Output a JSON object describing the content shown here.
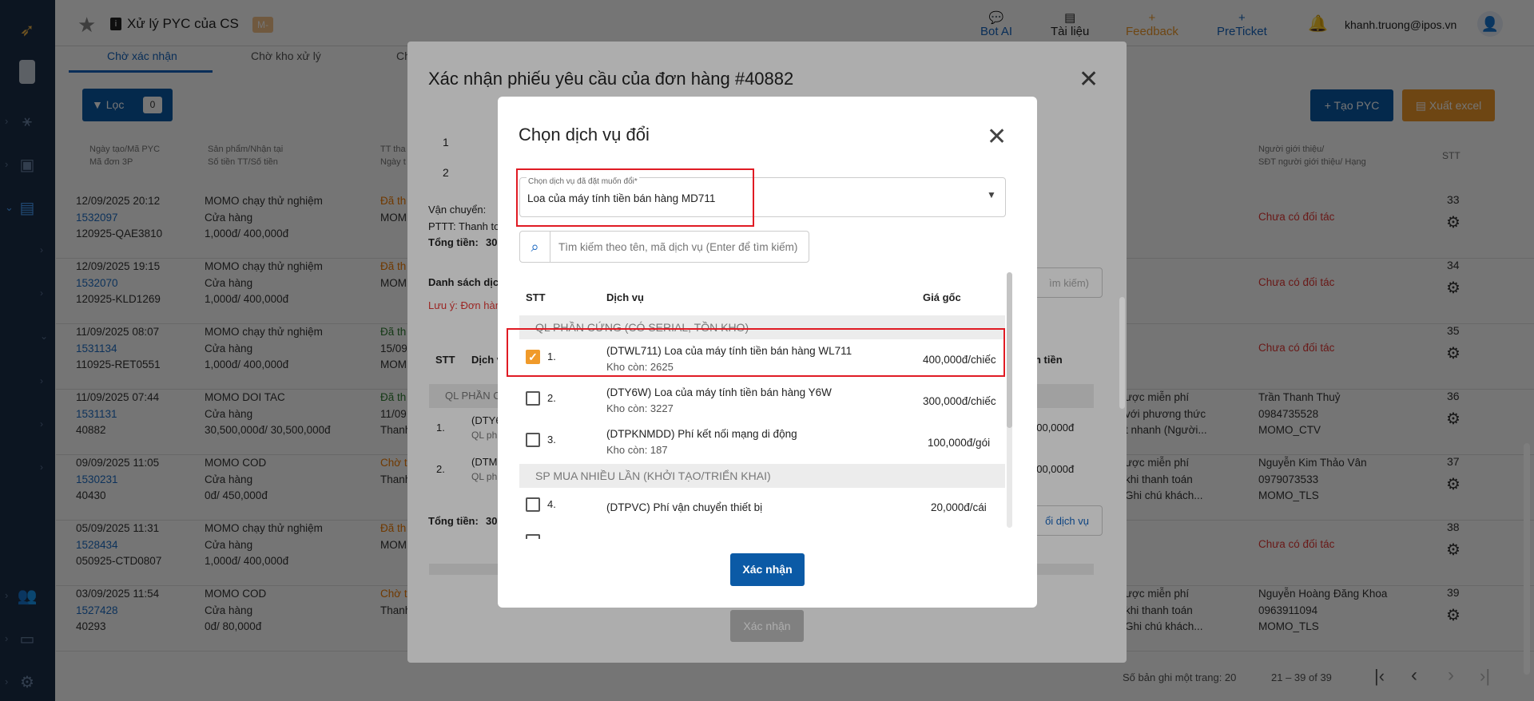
{
  "app": {
    "title": "Xử lý PYC của CS",
    "badge": "M-",
    "user": "khanh.truong@ipos.vn"
  },
  "topbar": {
    "bot_ai": "Bot AI",
    "tai_lieu": "Tài liệu",
    "feedback": "Feedback",
    "preticket": "PreTicket"
  },
  "tabs": [
    "Chờ xác nhận",
    "Chờ kho xử lý",
    "Ch"
  ],
  "toolbar": {
    "filter": "Lọc",
    "filter_count": "0",
    "create": "Tạo PYC",
    "export": "Xuất excel"
  },
  "table": {
    "headers": {
      "col1a": "Ngày tạo/Mã PYC",
      "col1b": "Mã đơn 3P",
      "col2a": "Sản phẩm/Nhận tại",
      "col2b": "Số tiền TT/Số tiền",
      "col3a": "TT tha",
      "col3b": "Ngày t",
      "col4a": "Người giới thiệu/",
      "col4b": "SĐT người giới thiệu/ Hạng",
      "stt": "STT"
    },
    "rows": [
      {
        "date": "12/09/2025 20:12",
        "code": "1532097",
        "ext": "120925-QAE3810",
        "p1": "MOMO chạy thử nghiệm",
        "p2": "Cửa hàng",
        "p3": "1,000đ/ 400,000đ",
        "s1": "Đã th",
        "s2": "MOM",
        "s3": "",
        "m1": "",
        "m2": "",
        "m3": "",
        "r1": "Chưa có đối tác",
        "r2": "",
        "r3": "",
        "stt": "33"
      },
      {
        "date": "12/09/2025 19:15",
        "code": "1532070",
        "ext": "120925-KLD1269",
        "p1": "MOMO chạy thử nghiệm",
        "p2": "Cửa hàng",
        "p3": "1,000đ/ 400,000đ",
        "s1": "Đã th",
        "s2": "MOM",
        "s3": "",
        "m1": "",
        "m2": "",
        "m3": "",
        "r1": "Chưa có đối tác",
        "r2": "",
        "r3": "",
        "stt": "34"
      },
      {
        "date": "11/09/2025 08:07",
        "code": "1531134",
        "ext": "110925-RET0551",
        "p1": "MOMO chạy thử nghiệm",
        "p2": "Cửa hàng",
        "p3": "1,000đ/ 400,000đ",
        "s1": "Đã th",
        "s2": "15/09",
        "s3": "MOM",
        "m1": "",
        "m2": "",
        "m3": "",
        "r1": "Chưa có đối tác",
        "r2": "",
        "r3": "",
        "stt": "35"
      },
      {
        "date": "11/09/2025 07:44",
        "code": "1531131",
        "ext": "40882",
        "p1": "MOMO DOI TAC",
        "p2": "Cửa hàng",
        "p3": "30,500,000đ/ 30,500,000đ",
        "s1": "Đã th",
        "s2": "11/09",
        "s3": "Thanh",
        "m1": "ược miễn phí",
        "m2": "với phương thức",
        "m3": "t nhanh (Người...",
        "r1": "Trần Thanh Thuỷ",
        "r2": "0984735528",
        "r3": "MOMO_CTV",
        "stt": "36"
      },
      {
        "date": "09/09/2025 11:05",
        "code": "1530231",
        "ext": "40430",
        "p1": "MOMO COD",
        "p2": "Cửa hàng",
        "p3": "0đ/ 450,000đ",
        "s1": "Chờ t",
        "s2": "Thanh",
        "s3": "",
        "m1": "ược miễn phí",
        "m2": "khi thanh toán",
        "m3": "Ghi chú khách...",
        "r1": "Nguyễn Kim Thảo Vân",
        "r2": "0979073533",
        "r3": "MOMO_TLS",
        "stt": "37"
      },
      {
        "date": "05/09/2025 11:31",
        "code": "1528434",
        "ext": "050925-CTD0807",
        "p1": "MOMO chạy thử nghiệm",
        "p2": "Cửa hàng",
        "p3": "1,000đ/ 400,000đ",
        "s1": "Đã th",
        "s2": "MOM",
        "s3": "",
        "m1": "",
        "m2": "",
        "m3": "",
        "r1": "Chưa có đối tác",
        "r2": "",
        "r3": "",
        "stt": "38"
      },
      {
        "date": "03/09/2025 11:54",
        "code": "1527428",
        "ext": "40293",
        "p1": "MOMO COD",
        "p2": "Cửa hàng",
        "p3": "0đ/ 80,000đ",
        "s1": "Chờ t",
        "s2": "Thanh",
        "s3": "",
        "m1": "ược miễn phí",
        "m2": "khi thanh toán",
        "m3": "Ghi chú khách...",
        "r1": "Nguyễn Hoàng Đăng Khoa",
        "r2": "0963911094",
        "r3": "MOMO_TLS",
        "stt": "39"
      }
    ]
  },
  "pagination": {
    "per_page": "Số bản ghi một trang: 20",
    "range": "21 – 39 of 39"
  },
  "modal1": {
    "title": "Xác nhận phiếu yêu cầu của đơn hàng #40882",
    "row_nums": [
      "1",
      "2"
    ],
    "van_chuyen": "Vận chuyển:",
    "pttt": "PTTT: Thanh to",
    "tong_tien": "Tổng tiền:",
    "tong_val": "30",
    "danh_sach": "Danh sách dịch",
    "luu_y": "Lưu ý: Đơn hàn",
    "search_stub": "ìm kiếm)",
    "col_stt": "STT",
    "col_dv": "Dịch v",
    "col_tien": "n tiền",
    "grp": "QL PHẦN C",
    "items": [
      {
        "n": "1.",
        "a": "(DTY6",
        "b": "QL ph",
        "amt": "000,000đ"
      },
      {
        "n": "2.",
        "a": "(DTM",
        "b": "QL ph",
        "amt": "500,000đ"
      }
    ],
    "tong2": "Tổng tiền:",
    "tong2_val": "30",
    "doi_dv": "ổi dịch vụ",
    "confirm": "Xác nhận"
  },
  "modal2": {
    "title": "Chọn dịch vụ đổi",
    "select_label": "Chọn dịch vụ đã đặt muốn đổi*",
    "select_value": "Loa của máy tính tiền bán hàng MD711",
    "search_placeholder": "Tìm kiếm theo tên, mã dịch vụ (Enter để tìm kiếm)",
    "col_stt": "STT",
    "col_dv": "Dịch vụ",
    "col_gia": "Giá gốc",
    "group1": "QL PHẦN CỨNG (CÓ SERIAL, TỒN KHO)",
    "group2": "SP MUA NHIỀU LẦN (KHỞI TẠO/TRIỂN KHAI)",
    "items": [
      {
        "n": "1.",
        "name": "(DTWL711) Loa của máy tính tiền bán hàng WL711",
        "stock": "Kho còn: 2625",
        "price": "400,000đ/chiếc",
        "checked": true
      },
      {
        "n": "2.",
        "name": "(DTY6W) Loa của máy tính tiền bán hàng Y6W",
        "stock": "Kho còn: 3227",
        "price": "300,000đ/chiếc",
        "checked": false
      },
      {
        "n": "3.",
        "name": "(DTPKNMDD) Phí kết nối mạng di động",
        "stock": "Kho còn: 187",
        "price": "100,000đ/gói",
        "checked": false
      },
      {
        "n": "4.",
        "name": "(DTPVC) Phí vận chuyển thiết bị",
        "stock": "",
        "price": "20,000đ/cái",
        "checked": false
      }
    ],
    "confirm": "Xác nhận"
  },
  "colors": {
    "primary": "#0b5aa6",
    "accent": "#f09a2a",
    "danger": "#e53935",
    "sidebar": "#1d2e4a"
  }
}
